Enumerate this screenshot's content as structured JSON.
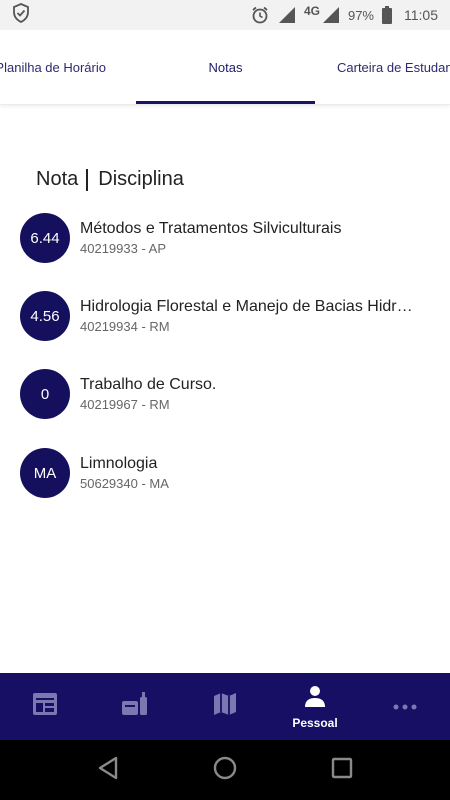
{
  "status_bar": {
    "network": "4G",
    "battery": "97%",
    "time": "11:05"
  },
  "tabs": [
    {
      "label": "Planilha de Horário"
    },
    {
      "label": "Notas"
    },
    {
      "label": "Carteira de Estudante"
    }
  ],
  "list_header": {
    "grade_col": "Nota",
    "subject_col": "Disciplina"
  },
  "grades": [
    {
      "grade": "6.44",
      "subject": "Métodos e Tratamentos Silviculturais",
      "code": "40219933 - AP"
    },
    {
      "grade": "4.56",
      "subject": "Hidrologia Florestal e Manejo de Bacias Hidrográficas",
      "code": "40219934 - RM"
    },
    {
      "grade": "0",
      "subject": "Trabalho de Curso.",
      "code": "40219967 - RM"
    },
    {
      "grade": "MA",
      "subject": "Limnologia",
      "code": "50629340 - MA"
    }
  ],
  "bottom_nav": {
    "items": [
      {
        "icon": "schedule-icon"
      },
      {
        "icon": "bag-icon"
      },
      {
        "icon": "map-icon"
      },
      {
        "icon": "person-icon",
        "label": "Pessoal"
      },
      {
        "icon": "more-icon"
      }
    ]
  },
  "colors": {
    "primary": "#15105e",
    "nav_bg": "#160f64",
    "tab_text": "#2d2a6e"
  }
}
